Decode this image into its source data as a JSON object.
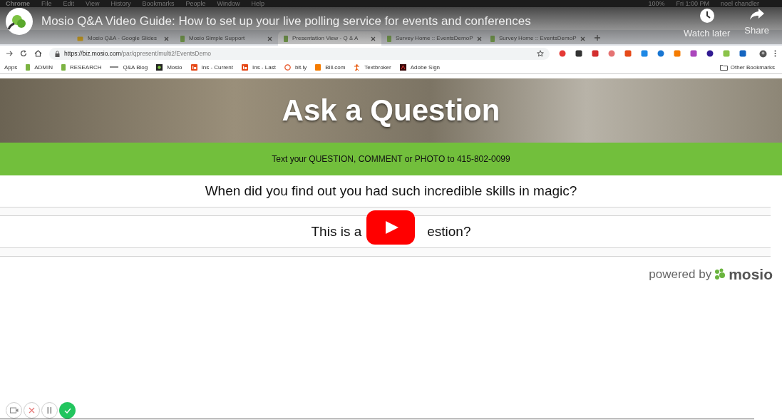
{
  "menu_bar": {
    "items": [
      "Chrome",
      "File",
      "Edit",
      "View",
      "History",
      "Bookmarks",
      "People",
      "Window",
      "Help"
    ],
    "battery": "100%",
    "clock": "Fri 1:00 PM",
    "user": "noel chandler"
  },
  "video": {
    "title": "Mosio Q&A Video Guide: How to set up your live polling service for events and conferences",
    "actions": [
      {
        "kind": "watch_later",
        "label": "Watch later"
      },
      {
        "kind": "share",
        "label": "Share"
      }
    ]
  },
  "browser": {
    "tabs": [
      {
        "title": "Mosio Q&A - Google Slides",
        "kind": "slides",
        "selected": false
      },
      {
        "title": "Mosio Simple Support",
        "kind": "sheet",
        "selected": false
      },
      {
        "title": "Presentation View - Q & A",
        "kind": "sheet",
        "selected": true
      },
      {
        "title": "Survey Home :: EventsDemoP",
        "kind": "sheet",
        "selected": false
      },
      {
        "title": "Survey Home :: EventsDemoP",
        "kind": "sheet",
        "selected": false
      }
    ],
    "address": {
      "host": "https://biz.mosio.com",
      "path": "/par/qpresent/multi2/EventsDemo"
    },
    "bookmarks": [
      {
        "label": "Apps",
        "kind": "apps"
      },
      {
        "label": "ADMIN",
        "kind": "sheet"
      },
      {
        "label": "RESEARCH",
        "kind": "sheet"
      },
      {
        "label": "Q&A Blog",
        "kind": "blog"
      },
      {
        "label": "Mosio",
        "kind": "mosio"
      },
      {
        "label": "Ins - Current",
        "kind": "ins"
      },
      {
        "label": "Ins - Last",
        "kind": "ins"
      },
      {
        "label": "bit.ly",
        "kind": "bitly"
      },
      {
        "label": "Bill.com",
        "kind": "bill"
      },
      {
        "label": "Textbroker",
        "kind": "textbroker"
      },
      {
        "label": "Adobe Sign",
        "kind": "adobe"
      }
    ],
    "other_bookmarks": "Other Bookmarks"
  },
  "page": {
    "banner_title": "Ask a Question",
    "instruction": "Text your QUESTION, COMMENT or PHOTO to 415-802-0099",
    "questions": [
      {
        "text_before": "When did you find out you had such incredible skills in magic?"
      },
      {
        "text_before": "This is a",
        "text_after": "estion?"
      }
    ],
    "powered_by": "powered by",
    "brand": "mosio"
  },
  "recorder": [
    {
      "kind": "camera"
    },
    {
      "kind": "cancel"
    },
    {
      "kind": "pause"
    },
    {
      "kind": "done"
    }
  ]
}
